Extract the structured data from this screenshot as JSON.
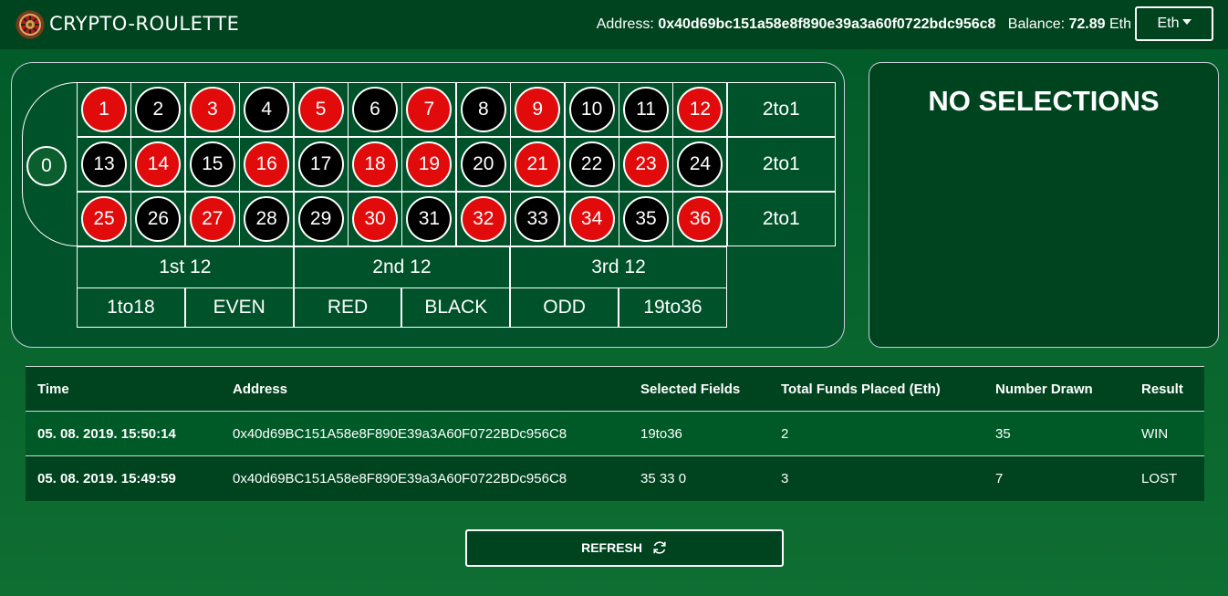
{
  "brand": "CRYPTO-ROULETTE",
  "nav": {
    "address_label": "Address:",
    "address": "0x40d69bc151a58e8f890e39a3a60f0722bdc956c8",
    "balance_label": "Balance:",
    "balance": "72.89",
    "balance_unit": "Eth",
    "currency_button": "Eth"
  },
  "board": {
    "zero": "0",
    "numbers": [
      {
        "n": "1",
        "color": "red"
      },
      {
        "n": "2",
        "color": "black"
      },
      {
        "n": "3",
        "color": "red"
      },
      {
        "n": "4",
        "color": "black"
      },
      {
        "n": "5",
        "color": "red"
      },
      {
        "n": "6",
        "color": "black"
      },
      {
        "n": "7",
        "color": "red"
      },
      {
        "n": "8",
        "color": "black"
      },
      {
        "n": "9",
        "color": "red"
      },
      {
        "n": "10",
        "color": "black"
      },
      {
        "n": "11",
        "color": "black"
      },
      {
        "n": "12",
        "color": "red"
      },
      {
        "n": "13",
        "color": "black"
      },
      {
        "n": "14",
        "color": "red"
      },
      {
        "n": "15",
        "color": "black"
      },
      {
        "n": "16",
        "color": "red"
      },
      {
        "n": "17",
        "color": "black"
      },
      {
        "n": "18",
        "color": "red"
      },
      {
        "n": "19",
        "color": "red"
      },
      {
        "n": "20",
        "color": "black"
      },
      {
        "n": "21",
        "color": "red"
      },
      {
        "n": "22",
        "color": "black"
      },
      {
        "n": "23",
        "color": "red"
      },
      {
        "n": "24",
        "color": "black"
      },
      {
        "n": "25",
        "color": "red"
      },
      {
        "n": "26",
        "color": "black"
      },
      {
        "n": "27",
        "color": "red"
      },
      {
        "n": "28",
        "color": "black"
      },
      {
        "n": "29",
        "color": "black"
      },
      {
        "n": "30",
        "color": "red"
      },
      {
        "n": "31",
        "color": "black"
      },
      {
        "n": "32",
        "color": "red"
      },
      {
        "n": "33",
        "color": "black"
      },
      {
        "n": "34",
        "color": "red"
      },
      {
        "n": "35",
        "color": "black"
      },
      {
        "n": "36",
        "color": "red"
      }
    ],
    "columns": [
      "2to1",
      "2to1",
      "2to1"
    ],
    "dozens": [
      "1st 12",
      "2nd 12",
      "3rd 12"
    ],
    "outside": [
      "1to18",
      "EVEN",
      "RED",
      "BLACK",
      "ODD",
      "19to36"
    ]
  },
  "selection_panel": {
    "title": "NO SELECTIONS"
  },
  "history": {
    "headers": [
      "Time",
      "Address",
      "Selected Fields",
      "Total Funds Placed (Eth)",
      "Number Drawn",
      "Result"
    ],
    "rows": [
      [
        "05. 08. 2019. 15:50:14",
        "0x40d69BC151A58e8F890E39a3A60F0722BDc956C8",
        "19to36",
        "2",
        "35",
        "WIN"
      ],
      [
        "05. 08. 2019. 15:49:59",
        "0x40d69BC151A58e8F890E39a3A60F0722BDc956C8",
        "35 33 0",
        "3",
        "7",
        "LOST"
      ]
    ]
  },
  "refresh_button": "REFRESH",
  "icons": {
    "logo": "roulette-wheel-icon",
    "refresh": "refresh-icon",
    "dropdown": "caret-down-icon"
  },
  "colors": {
    "felt": "#005a28",
    "dark": "#00441f",
    "red": "#e10b0b",
    "black": "#000000"
  }
}
